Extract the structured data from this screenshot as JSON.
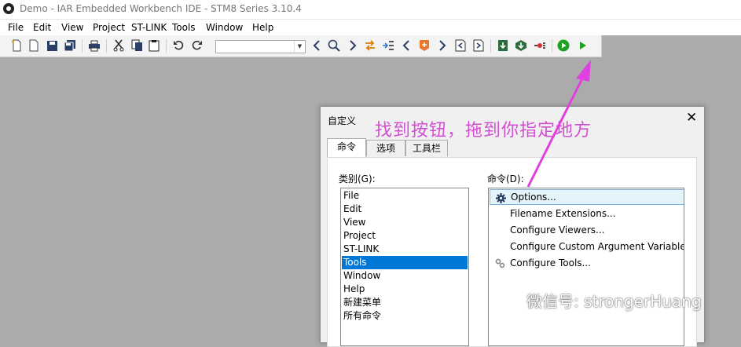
{
  "window": {
    "title": "Demo - IAR Embedded Workbench IDE - STM8 Series 3.10.4"
  },
  "menu": [
    "File",
    "Edit",
    "View",
    "Project",
    "ST-LINK",
    "Tools",
    "Window",
    "Help"
  ],
  "toolbar": {
    "combo_value": ""
  },
  "colors": {
    "annotation": "#d24fd2",
    "selection": "#0078d7",
    "run_green": "#21a121",
    "desktop": "#ababab"
  },
  "dialog": {
    "title": "自定义",
    "close_glyph": "✕",
    "tabs": [
      "命令",
      "选项",
      "工具栏"
    ],
    "categories_label": "类别(G):",
    "commands_label": "命令(D):",
    "categories": [
      "File",
      "Edit",
      "View",
      "Project",
      "ST-LINK",
      "Tools",
      "Window",
      "Help",
      "新建菜单",
      "所有命令"
    ],
    "selected_category": "Tools",
    "commands": [
      {
        "label": "Options...",
        "icon": "gear-icon"
      },
      {
        "label": "Filename Extensions...",
        "icon": ""
      },
      {
        "label": "Configure Viewers...",
        "icon": ""
      },
      {
        "label": "Configure Custom Argument Variables...",
        "icon": ""
      },
      {
        "label": "Configure Tools...",
        "icon": "tools-gear-icon"
      }
    ]
  },
  "annotation": {
    "text": "找到按钮，拖到你指定地方"
  },
  "watermark": {
    "text": "微信号: strongerHuang"
  }
}
